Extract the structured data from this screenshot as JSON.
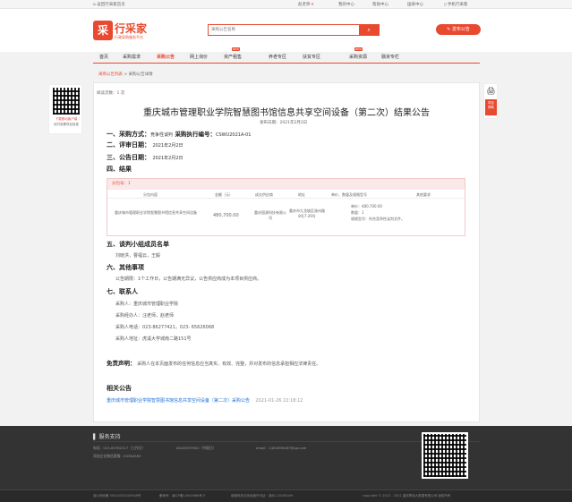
{
  "topbar": {
    "home": "返回行采家首页",
    "user": "赵老师",
    "items": [
      "我的中心",
      "帮助中心",
      "国采中心",
      "手机行采家"
    ]
  },
  "header": {
    "brand": "行采家",
    "slogan": "行政采购服务平台",
    "search_placeholder": "采购公告名称",
    "publish": "发布公告"
  },
  "nav": {
    "items": [
      "首页",
      "采购需求",
      "采购公告",
      "网上询价",
      "资产租售",
      "养老专区",
      "扶贫专区",
      "采购资源",
      "融资专栏"
    ],
    "new_badge": "NEW"
  },
  "breadcrumb": {
    "link": "采购公告列表",
    "sep": ">",
    "current": "采购公告详情"
  },
  "article": {
    "views_label": "阅读次数：",
    "views": "1",
    "title": "重庆城市管理职业学院智慧图书馆信息共享空间设备（第二次）结果公告",
    "date_label": "发布日期：",
    "date": "2021年2月2日",
    "s1": "一、采购方式：",
    "s1_val": "竞争性谈判",
    "s1_b": "采购执行编号：",
    "s1_code": "CSWU2021A-01",
    "s2": "二、评审日期：",
    "s2_val": "2021年2月2日",
    "s3": "三、公告日期：",
    "s3_val": "2021年2月2日",
    "s4": "四、结果",
    "table": {
      "pkg": "分包号：1",
      "headers": [
        "分包内容",
        "金额（元）",
        "成交供应商",
        "地址",
        "单价、数量及规格型号",
        "其他要求"
      ],
      "row": {
        "content": "重庆城市管理职业学院智慧图书馆信息共享空间设备",
        "amount": "480,700.00",
        "supplier": "重庆国源科技有限公司",
        "address": "重庆市九龙坡区渝州路8号7-29号",
        "spec": [
          "单价：480,700.00",
          "数量：1",
          "规格型号：符合竞争性谈判文件。"
        ],
        "other": ""
      }
    },
    "s5": "五、谈判小组成员名单",
    "s5_val": "刘晓洪，曹福云，王毅",
    "s6": "六、其他事项",
    "s6_val": "公告期限：1个工作日，公告期满无异议，公告供应商成为本项目供应商。",
    "s7": "七、联系人",
    "contacts": [
      "采购人：重庆城市管理职业学院",
      "采购经办人：汪老师，赵老师",
      "采购人电话：023-86277421，023- 65626068",
      "采购人地址：虎溪大学城南二路151号"
    ],
    "disclaimer_label": "免责声明：",
    "disclaimer": "采购人在本页面发布的任何信息应当真实、有效、完整，并对发布的信息承担相应法律责任。",
    "related_title": "相关公告",
    "related": [
      {
        "title": "重庆城市管理职业学院智慧图书馆信息共享空间设备（第二次）采购公告",
        "date": "2021-01-26 22:18:12"
      }
    ]
  },
  "left_qr": {
    "t1": "下载移动客户端",
    "t2": "实时查看项目信息"
  },
  "side": {
    "print": "🖨",
    "project": "项目\n帮助"
  },
  "footer": {
    "title": "服务支持",
    "phone1": "电话：023-63782217（工作日）",
    "phone2": "18183597601（节假日）",
    "email": "email：1461899487@qq.com",
    "wechat": "添加企业微信客服：83384563",
    "bottom": [
      "渝公网安备 50010302000948号",
      "备案号：渝ICP备14004966号-5",
      "增值电信业务经营许可证：渝B2-20190009",
      "copyright © 2015 - 2021 重庆擎焰大数据有限公司 版权所有"
    ]
  }
}
